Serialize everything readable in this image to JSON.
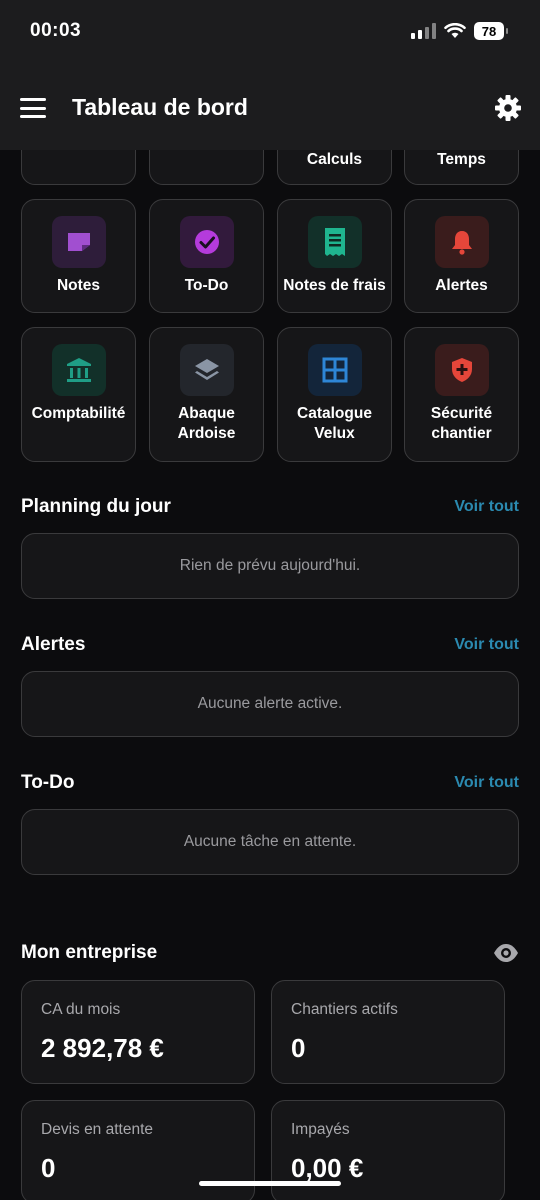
{
  "status_bar": {
    "time": "00:03",
    "battery": "78"
  },
  "header": {
    "title": "Tableau de bord",
    "menu_icon": "hamburger-icon",
    "settings_icon": "gear-icon"
  },
  "tiles_partial": [
    {
      "label": ""
    },
    {
      "label": ""
    },
    {
      "label": "Calculs"
    },
    {
      "label": "Temps"
    }
  ],
  "tiles": [
    {
      "label": "Notes",
      "icon": "note-icon",
      "color": "#a14fd0"
    },
    {
      "label": "To-Do",
      "icon": "check-circle-icon",
      "color": "#b53bdc"
    },
    {
      "label": "Notes de frais",
      "icon": "receipt-icon",
      "color": "#1fb58f"
    },
    {
      "label": "Alertes",
      "icon": "bell-icon",
      "color": "#e5463a"
    },
    {
      "label": "Comptabilité",
      "icon": "bank-icon",
      "color": "#1f9e86"
    },
    {
      "label": "Abaque Ardoise",
      "icon": "layers-icon",
      "color": "#8a95a5"
    },
    {
      "label": "Catalogue Velux",
      "icon": "window-icon",
      "color": "#2e86d6"
    },
    {
      "label": "Sécurité chantier",
      "icon": "shield-plus-icon",
      "color": "#e5463a"
    }
  ],
  "sections": {
    "planning": {
      "title": "Planning du jour",
      "see_all": "Voir tout",
      "empty": "Rien de prévu aujourd'hui."
    },
    "alerts": {
      "title": "Alertes",
      "see_all": "Voir tout",
      "empty": "Aucune alerte active."
    },
    "todo": {
      "title": "To-Do",
      "see_all": "Voir tout",
      "empty": "Aucune tâche en attente."
    }
  },
  "company": {
    "title": "Mon entreprise",
    "visibility_icon": "eye-icon",
    "stats": [
      {
        "label": "CA du mois",
        "value": "2 892,78 €"
      },
      {
        "label": "Chantiers actifs",
        "value": "0"
      },
      {
        "label": "Devis en attente",
        "value": "0"
      },
      {
        "label": "Impayés",
        "value": "0,00 €"
      }
    ]
  },
  "colors": {
    "background": "#0c0c0e",
    "card": "#161618",
    "border": "#3a3a3c",
    "accent_link": "#2b8ab0"
  }
}
